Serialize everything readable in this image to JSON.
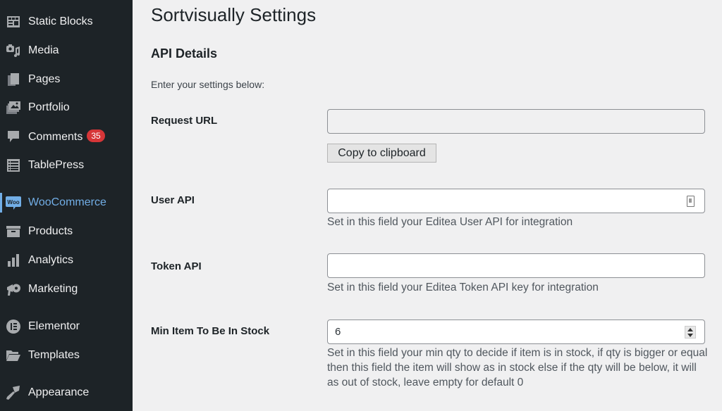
{
  "sidebar": {
    "items": [
      {
        "label": "Static Blocks",
        "icon": "static-blocks-icon"
      },
      {
        "label": "Media",
        "icon": "media-icon"
      },
      {
        "label": "Pages",
        "icon": "pages-icon"
      },
      {
        "label": "Portfolio",
        "icon": "portfolio-icon"
      },
      {
        "label": "Comments",
        "icon": "comments-icon",
        "badge": "35"
      },
      {
        "label": "TablePress",
        "icon": "tablepress-icon"
      },
      {
        "label": "WooCommerce",
        "icon": "woocommerce-icon",
        "active": true
      },
      {
        "label": "Products",
        "icon": "products-icon"
      },
      {
        "label": "Analytics",
        "icon": "analytics-icon"
      },
      {
        "label": "Marketing",
        "icon": "marketing-icon"
      },
      {
        "label": "Elementor",
        "icon": "elementor-icon"
      },
      {
        "label": "Templates",
        "icon": "templates-icon"
      },
      {
        "label": "Appearance",
        "icon": "appearance-icon"
      }
    ],
    "woo_icon_text": "Woo",
    "elementor_icon_text": "E"
  },
  "page": {
    "title": "Sortvisually Settings",
    "section_title": "API Details",
    "intro": "Enter your settings below:"
  },
  "fields": {
    "request_url": {
      "label": "Request URL",
      "value": "",
      "copy_button": "Copy to clipboard"
    },
    "user_api": {
      "label": "User API",
      "value": "",
      "description": "Set in this field your Editea User API for integration"
    },
    "token_api": {
      "label": "Token API",
      "value": "",
      "description": "Set in this field your Editea Token API key for integration"
    },
    "min_stock": {
      "label": "Min Item To Be In Stock",
      "value": "6",
      "description": "Set in this field your min qty to decide if item is in stock, if qty is bigger or equal then this field the item will show as in stock else if the qty will be below, it will as out of stock, leave empty for default 0"
    }
  },
  "colors": {
    "sidebar_bg": "#1d2327",
    "accent": "#72aee6",
    "badge": "#d63638",
    "page_bg": "#f0f0f1"
  }
}
